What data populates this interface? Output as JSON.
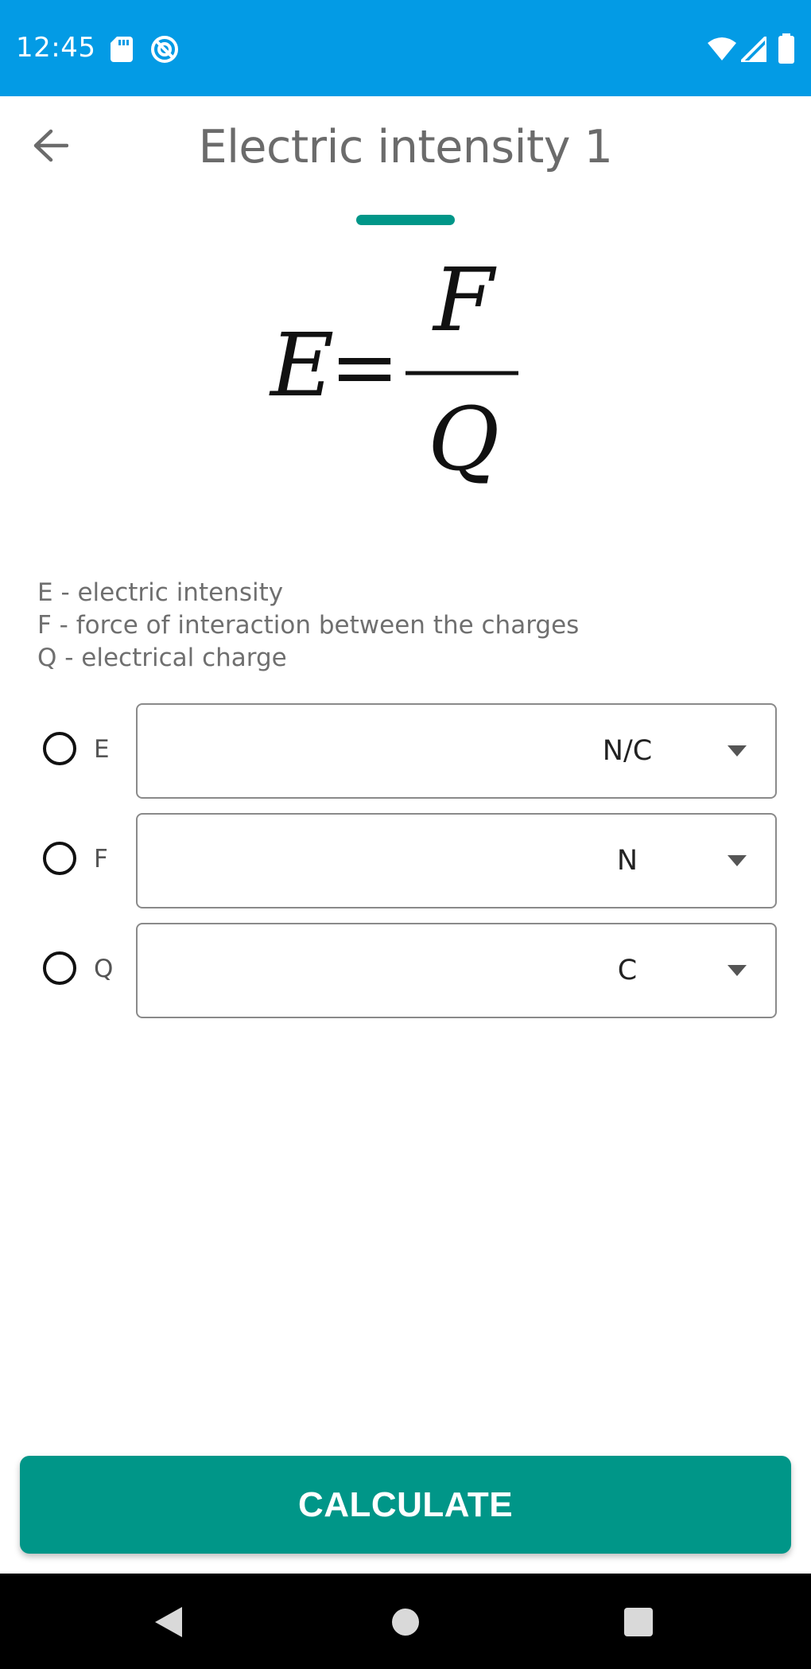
{
  "status_bar": {
    "time": "12:45",
    "left_icons": [
      "sd-card-icon",
      "sync-icon"
    ],
    "right_icons": [
      "wifi-icon",
      "signal-icon",
      "battery-icon"
    ],
    "background": "#039be5"
  },
  "header": {
    "title": "Electric intensity 1",
    "back_icon": "arrow-left-icon"
  },
  "formula": {
    "lhs": "E",
    "equals": "=",
    "numerator": "F",
    "denominator": "Q"
  },
  "legend": [
    "E - electric intensity",
    "F - force of interaction between the charges",
    "Q - electrical charge"
  ],
  "rows": [
    {
      "label": "E",
      "value": "",
      "unit": "N/C",
      "selected": false
    },
    {
      "label": "F",
      "value": "",
      "unit": "N",
      "selected": false
    },
    {
      "label": "Q",
      "value": "",
      "unit": "C",
      "selected": false
    }
  ],
  "calculate_label": "CALCULATE",
  "nav_icons": [
    "back-triangle-icon",
    "home-circle-icon",
    "recents-square-icon"
  ],
  "colors": {
    "accent": "#009688",
    "status_bar": "#039be5"
  }
}
